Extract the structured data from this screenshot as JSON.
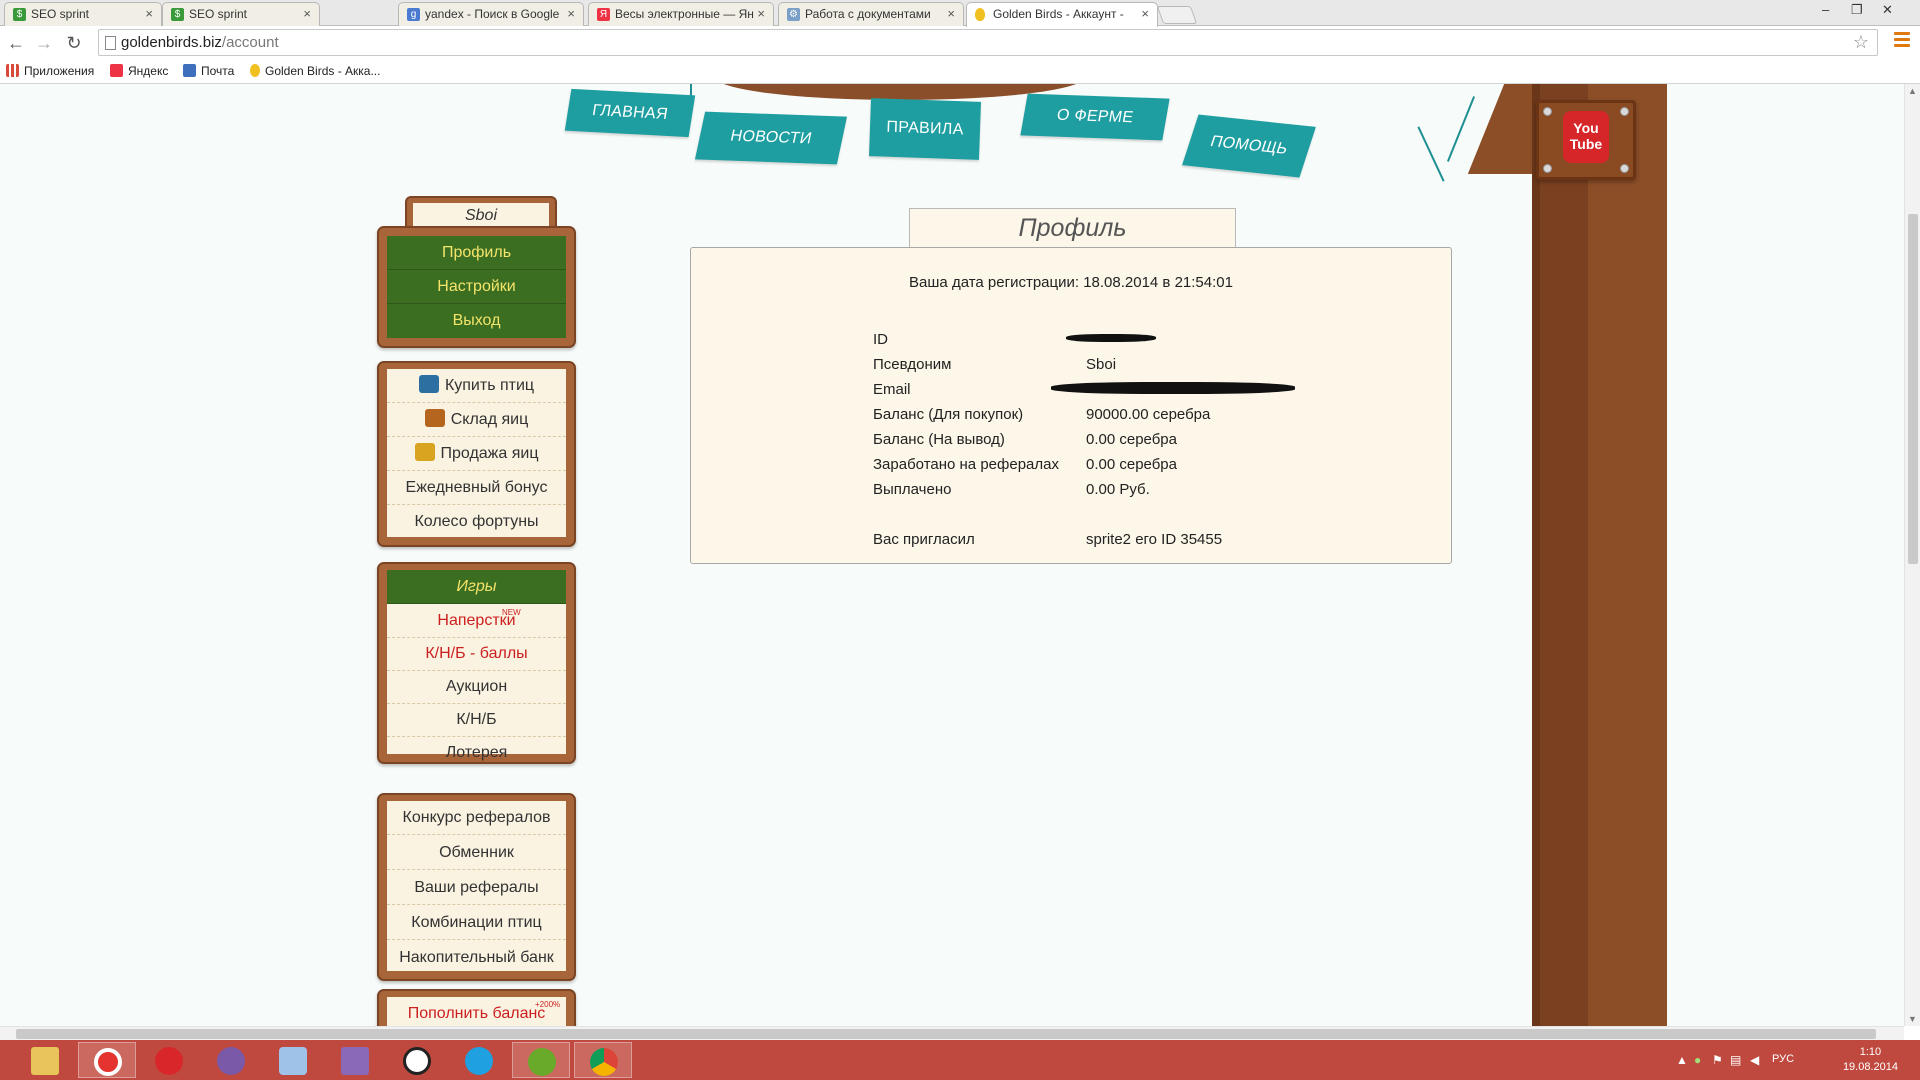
{
  "browser": {
    "tabs": [
      {
        "title": "SEO sprint",
        "favicon_color": "#3a9a3a",
        "favicon_glyph": "$"
      },
      {
        "title": "SEO sprint",
        "favicon_color": "#3a9a3a",
        "favicon_glyph": "$"
      },
      {
        "title": "yandex - Поиск в Google",
        "favicon_color": "#4a7bd0",
        "favicon_glyph": "g"
      },
      {
        "title": "Весы электронные — Ян",
        "favicon_color": "#e34",
        "favicon_glyph": "Я"
      },
      {
        "title": "Работа с документами",
        "favicon_color": "#7aa0c8",
        "favicon_glyph": "⚙"
      },
      {
        "title": "Golden Birds - Аккаунт - ",
        "favicon_color": "#f0c020",
        "favicon_glyph": ""
      }
    ],
    "tab_close_glyph": "×",
    "window_controls": {
      "minimize": "–",
      "maximize": "❐",
      "close": "✕"
    },
    "nav": {
      "back": "←",
      "forward": "→",
      "reload": "↻"
    },
    "url": {
      "host": "goldenbirds.biz",
      "path": "/account"
    },
    "star_glyph": "☆",
    "bookmarks": [
      {
        "label": "Приложения",
        "icon": "apps-icon",
        "color": "#d84b3a"
      },
      {
        "label": "Яндекс",
        "icon": "yandex-icon",
        "color": "#e34"
      },
      {
        "label": "Почта",
        "icon": "mail-icon",
        "color": "#3d6fbd"
      },
      {
        "label": "Golden Birds - Акка...",
        "icon": "egg-icon",
        "color": "#f0c020"
      }
    ]
  },
  "site": {
    "nav": [
      {
        "label": "ГЛАВНАЯ"
      },
      {
        "label": "НОВОСТИ"
      },
      {
        "label": "ПРАВИЛА"
      },
      {
        "label": "О ФЕРМЕ"
      },
      {
        "label": "ПОМОЩЬ"
      }
    ],
    "youtube": {
      "line1": "You",
      "line2": "Tube"
    },
    "user_name": "Sboi",
    "account_menu": [
      {
        "label": "Профиль"
      },
      {
        "label": "Настройки"
      },
      {
        "label": "Выход"
      }
    ],
    "farm_menu": [
      {
        "label": "Купить птиц",
        "icon": "cart-icon",
        "icon_color": "#2c6fa0"
      },
      {
        "label": "Склад яиц",
        "icon": "crate-icon",
        "icon_color": "#b5651d"
      },
      {
        "label": "Продажа яиц",
        "icon": "coins-icon",
        "icon_color": "#d9a520"
      },
      {
        "label": "Ежедневный бонус"
      },
      {
        "label": "Колесо фортуны"
      }
    ],
    "games_menu": {
      "header": "Игры",
      "items": [
        {
          "label": "Наперстки",
          "badge": "NEW",
          "red": true
        },
        {
          "label": "К/Н/Б - баллы",
          "red": true
        },
        {
          "label": "Аукцион"
        },
        {
          "label": "К/Н/Б"
        },
        {
          "label": "Лотерея"
        }
      ]
    },
    "extra_menu": [
      {
        "label": "Конкурс рефералов"
      },
      {
        "label": "Обменник"
      },
      {
        "label": "Ваши рефералы"
      },
      {
        "label": "Комбинации птиц"
      },
      {
        "label": "Накопительный банк"
      }
    ],
    "topup": {
      "label": "Пополнить баланс",
      "badge": "+200%"
    }
  },
  "profile": {
    "title": "Профиль",
    "registration": "Ваша дата регистрации: 18.08.2014 в 21:54:01",
    "rows": [
      {
        "key": "ID",
        "value": ""
      },
      {
        "key": "Псевдоним",
        "value": "Sboi"
      },
      {
        "key": "Email",
        "value": ""
      },
      {
        "key": "Баланс (Для покупок)",
        "value": "90000.00 серебра"
      },
      {
        "key": "Баланс (На вывод)",
        "value": "0.00 серебра"
      },
      {
        "key": "Заработано на рефералах",
        "value": "0.00 серебра"
      },
      {
        "key": "Выплачено",
        "value": "0.00 Руб."
      },
      {
        "key": "Вас пригласил",
        "value": "sprite2 его ID 35455"
      }
    ]
  },
  "taskbar": {
    "apps": [
      {
        "name": "file-explorer-icon",
        "color": "#e8c45a"
      },
      {
        "name": "opera-icon",
        "color": "#e5342f",
        "active": true
      },
      {
        "name": "gift-icon",
        "color": "#d8262a"
      },
      {
        "name": "eclipse-icon",
        "color": "#7a5aa8"
      },
      {
        "name": "box-icon",
        "color": "#9fc3e8"
      },
      {
        "name": "visual-studio-icon",
        "color": "#8a6ab8"
      },
      {
        "name": "alien-icon",
        "color": "#ffffff"
      },
      {
        "name": "skype-icon",
        "color": "#1fa0e0"
      },
      {
        "name": "utorrent-icon",
        "color": "#6aaa2a",
        "active": true
      },
      {
        "name": "chrome-icon",
        "color": "#e0b020",
        "active": true
      }
    ],
    "lang": "РУС",
    "time": "1:10",
    "date": "19.08.2014"
  }
}
